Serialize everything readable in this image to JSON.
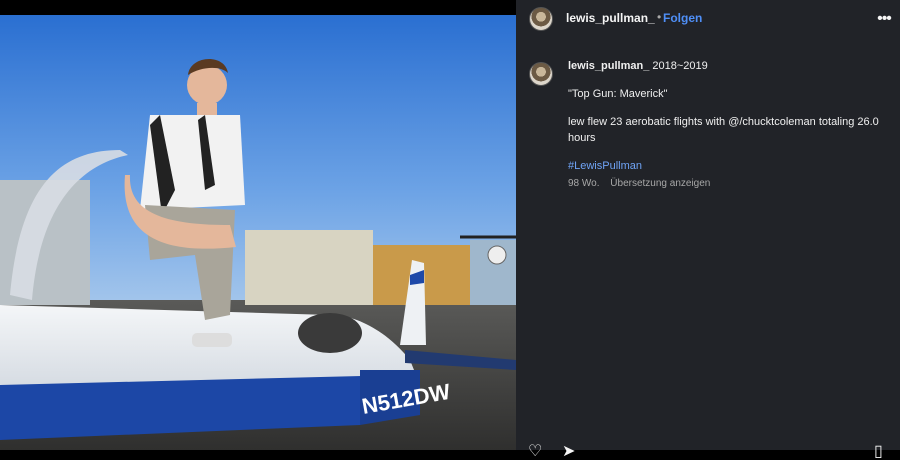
{
  "post": {
    "username": "lewis_pullman_",
    "separator": "•",
    "follow_label": "Folgen",
    "more_icon": "more-horizontal-icon"
  },
  "caption": {
    "username": "lewis_pullman_",
    "headline": "2018~2019",
    "line1": "\"Top Gun: Maverick\"",
    "line2": "lew flew 23 aerobatic flights with @/chucktcoleman totaling 26.0 hours",
    "hashtag": "#LewisPullman",
    "age": "98 Wo.",
    "translate_label": "Übersetzung anzeigen"
  },
  "photo": {
    "aircraft_registration": "N512DW"
  },
  "actions": {
    "like_icon": "heart-icon",
    "share_icon": "send-icon",
    "save_icon": "bookmark-icon"
  },
  "colors": {
    "panel_bg": "#212328",
    "link_blue": "#4f8ff7",
    "hashtag_blue": "#6fa3f5"
  }
}
